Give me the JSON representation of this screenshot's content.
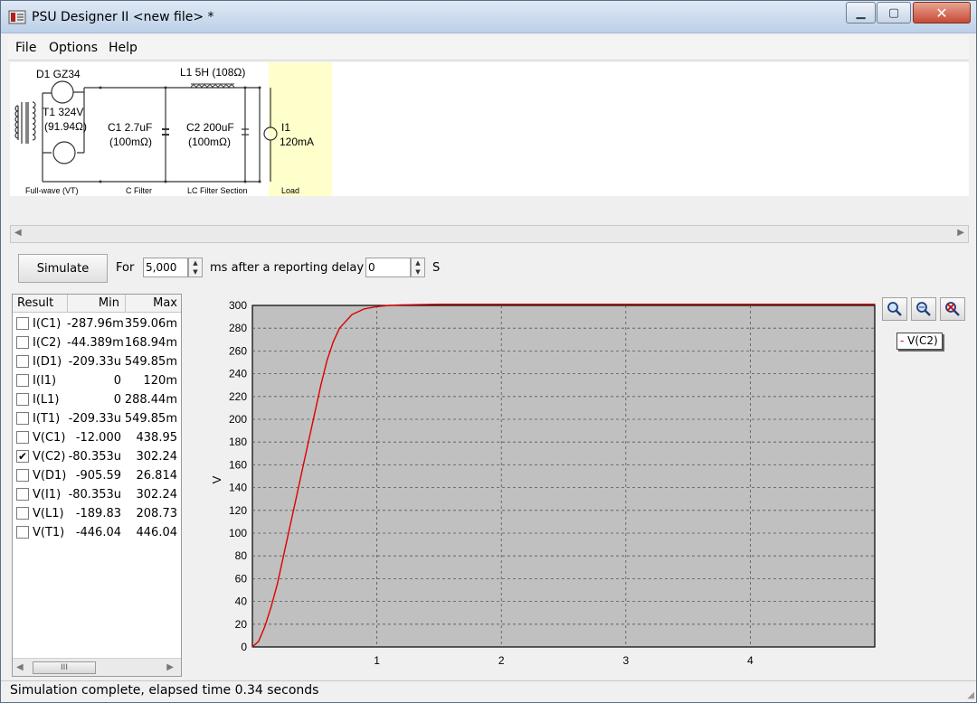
{
  "window": {
    "title": "PSU Designer II  <new file> *"
  },
  "menu": [
    "File",
    "Options",
    "Help"
  ],
  "schematic": {
    "d1": "D1  GZ34",
    "t1_line1": "T1 324V",
    "t1_line2": "(91.94Ω)",
    "c1_line1": "C1 2.7uF",
    "c1_line2": "(100mΩ)",
    "l1": "L1 5H (108Ω)",
    "c2_line1": "C2 200uF",
    "c2_line2": "(100mΩ)",
    "i1_line1": "I1",
    "i1_line2": "120mA",
    "sections": [
      "Full-wave (VT)",
      "C Filter",
      "LC Filter Section",
      "Load"
    ]
  },
  "controls": {
    "simulate": "Simulate",
    "for_label": "For",
    "duration": "5,000",
    "ms_label": "ms  after a reporting delay of",
    "delay": "0",
    "s_label": "S"
  },
  "results": {
    "headers": [
      "Result",
      "Min",
      "Max"
    ],
    "rows": [
      {
        "name": "I(C1)",
        "min": "-287.96m",
        "max": "359.06m",
        "checked": false
      },
      {
        "name": "I(C2)",
        "min": "-44.389m",
        "max": "168.94m",
        "checked": false
      },
      {
        "name": "I(D1)",
        "min": "-209.33u",
        "max": "549.85m",
        "checked": false
      },
      {
        "name": "I(I1)",
        "min": "0",
        "max": "120m",
        "checked": false
      },
      {
        "name": "I(L1)",
        "min": "0",
        "max": "288.44m",
        "checked": false
      },
      {
        "name": "I(T1)",
        "min": "-209.33u",
        "max": "549.85m",
        "checked": false
      },
      {
        "name": "V(C1)",
        "min": "-12.000",
        "max": "438.95",
        "checked": false
      },
      {
        "name": "V(C2)",
        "min": "-80.353u",
        "max": "302.24",
        "checked": true
      },
      {
        "name": "V(D1)",
        "min": "-905.59",
        "max": "26.814",
        "checked": false
      },
      {
        "name": "V(I1)",
        "min": "-80.353u",
        "max": "302.24",
        "checked": false
      },
      {
        "name": "V(L1)",
        "min": "-189.83",
        "max": "208.73",
        "checked": false
      },
      {
        "name": "V(T1)",
        "min": "-446.04",
        "max": "446.04",
        "checked": false
      }
    ],
    "scroll_thumb": "III"
  },
  "chart_data": {
    "type": "line",
    "title": "",
    "xlabel": "",
    "ylabel": "V",
    "xlim": [
      0,
      5
    ],
    "ylim": [
      0,
      300
    ],
    "x_ticks": [
      1,
      2,
      3,
      4
    ],
    "y_ticks": [
      0,
      20,
      40,
      60,
      80,
      100,
      120,
      140,
      160,
      180,
      200,
      220,
      240,
      260,
      280,
      300
    ],
    "grid": true,
    "legend": "top-right",
    "series": [
      {
        "name": "V(C2)",
        "color": "#e00000",
        "x": [
          0,
          0.05,
          0.1,
          0.15,
          0.2,
          0.25,
          0.3,
          0.35,
          0.4,
          0.45,
          0.5,
          0.55,
          0.6,
          0.65,
          0.7,
          0.8,
          0.9,
          1.0,
          1.1,
          1.2,
          1.5,
          2.0,
          3.0,
          4.0,
          5.0
        ],
        "y": [
          0,
          5,
          18,
          35,
          55,
          80,
          105,
          130,
          155,
          180,
          205,
          230,
          252,
          268,
          280,
          292,
          297,
          299,
          300,
          300.5,
          301,
          301,
          301,
          301,
          301
        ]
      }
    ]
  },
  "zoom_buttons": [
    "zoom-in-icon",
    "zoom-fit-icon",
    "zoom-reset-icon"
  ],
  "status": "Simulation complete, elapsed time 0.34 seconds",
  "colors": {
    "curve": "#e00000",
    "plot_bg": "#c0c0c0",
    "load_band": "#ffffcc"
  }
}
